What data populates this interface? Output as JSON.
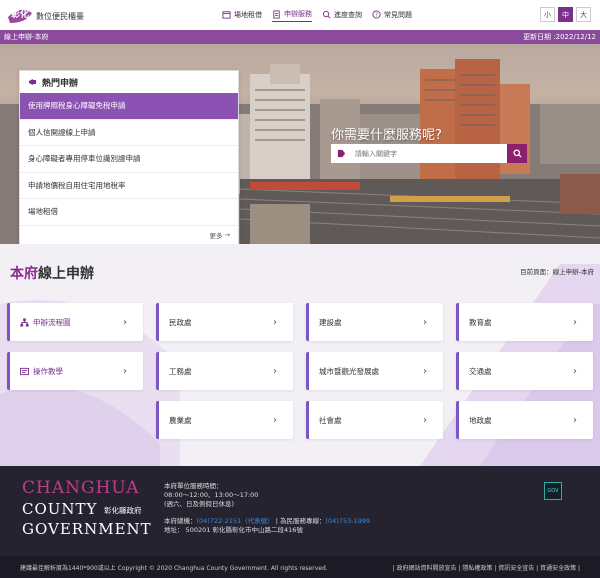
{
  "header": {
    "logo_text": "數位便民櫃臺",
    "nav": [
      {
        "label": "場地租借",
        "icon": "calendar-icon",
        "active": false
      },
      {
        "label": "申辦服務",
        "icon": "document-icon",
        "active": true
      },
      {
        "label": "進度查詢",
        "icon": "search-icon",
        "active": false
      },
      {
        "label": "常見問題",
        "icon": "question-icon",
        "active": false
      }
    ],
    "font_sizes": [
      "小",
      "中",
      "大"
    ]
  },
  "bar": {
    "left": "線上申辦-本府",
    "right": "更新日期 :2022/12/12"
  },
  "hot": {
    "title": "熱門申辦",
    "items": [
      "使用牌照稅身心障礙免稅申請",
      "個人信開證線上申請",
      "身心障礙者專用停車位識別證申請",
      "申請地價稅自用住宅用地稅率",
      "場地租借"
    ],
    "more": "更多"
  },
  "hero": {
    "question": "你需要什麼服務呢?",
    "search_placeholder": "請輸入關鍵字"
  },
  "section": {
    "title_highlight": "本府",
    "title_rest": "線上申辦",
    "breadcrumb": "目前頁面：線上申辦-本府"
  },
  "left_cards": [
    {
      "label": "申辦流程圖",
      "icon": "flowchart-icon"
    },
    {
      "label": "操作教學",
      "icon": "tutorial-icon"
    }
  ],
  "cards": [
    "民政處",
    "建設處",
    "教育處",
    "工務處",
    "城市暨觀光發展處",
    "交通處",
    "農業處",
    "社會處",
    "地政處"
  ],
  "footer": {
    "logo_line1": "CHANGHUA",
    "logo_line2": "COUNTY",
    "logo_line3": "GOVERNMENT",
    "logo_cn": "彰化縣政府",
    "hours_title": "本府單位服務時間：",
    "hours": "08:00～12:00、13:00～17:00",
    "hours_note": "(週六、日及例假日休息)",
    "phone_label": "本府總機：",
    "phone": "(04)722-2151（代表號）",
    "hotline_label": " | 為民服務專線：",
    "hotline": "(04)753-1999",
    "address": "地址： 500201 彰化縣彰化市中山路二段416號",
    "badge": "GOV"
  },
  "copyright": {
    "left": "建議最佳解析度為1440*900或以上 Copyright © 2020 Changhua County Government. All rights reserved.",
    "right": "| 政府網站資料開放宣告 | 隱私權政策 | 資訊安全宣告 | 資通安全政策 |"
  },
  "colors": {
    "brand": "#7a2f8c",
    "bar": "#8b4a9b",
    "card_accent": "#7d57c1",
    "footer": "#262330"
  }
}
